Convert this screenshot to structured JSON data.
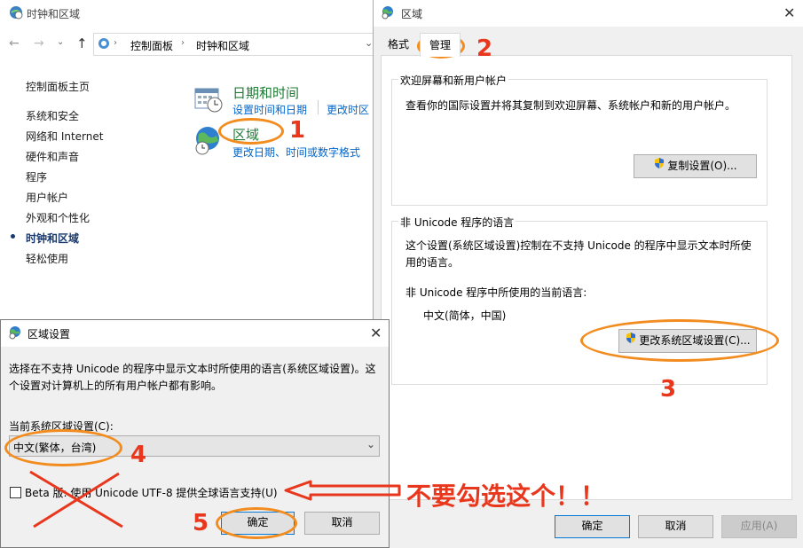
{
  "control_panel": {
    "title": "时钟和区域",
    "breadcrumb": [
      "控制面板",
      "时钟和区域"
    ],
    "sidebar": [
      {
        "label": "控制面板主页",
        "current": false
      },
      {
        "label": "系统和安全",
        "current": false
      },
      {
        "label": "网络和 Internet",
        "current": false
      },
      {
        "label": "硬件和声音",
        "current": false
      },
      {
        "label": "程序",
        "current": false
      },
      {
        "label": "用户帐户",
        "current": false
      },
      {
        "label": "外观和个性化",
        "current": false
      },
      {
        "label": "时钟和区域",
        "current": true
      },
      {
        "label": "轻松使用",
        "current": false
      }
    ],
    "datetime": {
      "title": "日期和时间",
      "link1": "设置时间和日期",
      "link2": "更改时区"
    },
    "region": {
      "title": "区域",
      "link1": "更改日期、时间或数字格式"
    }
  },
  "region_dialog": {
    "title": "区域",
    "tabs": [
      "格式",
      "管理"
    ],
    "welcome_group": {
      "title": "欢迎屏幕和新用户帐户",
      "desc": "查看你的国际设置并将其复制到欢迎屏幕、系统帐户和新的用户帐户。",
      "button": "复制设置(O)..."
    },
    "unicode_group": {
      "title": "非 Unicode 程序的语言",
      "desc_line1": "这个设置(系统区域设置)控制在不支持 Unicode 的程序中显示文本时所使",
      "desc_line2": "用的语言。",
      "current_label": "非 Unicode 程序中所使用的当前语言:",
      "current_value": "中文(简体，中国)",
      "button": "更改系统区域设置(C)..."
    },
    "footer": {
      "ok": "确定",
      "cancel": "取消",
      "apply": "应用(A)"
    }
  },
  "locale_dialog": {
    "title": "区域设置",
    "desc_line1": "选择在不支持 Unicode 的程序中显示文本时所使用的语言(系统区域设置)。这",
    "desc_line2": "个设置对计算机上的所有用户帐户都有影响。",
    "select_label": "当前系统区域设置(C):",
    "select_value": "中文(繁体，台湾)",
    "beta_checkbox": "Beta 版: 使用 Unicode UTF-8 提供全球语言支持(U)",
    "beta_checked": false,
    "ok": "确定",
    "cancel": "取消"
  },
  "annotations": {
    "n1": "1",
    "n2": "2",
    "n3": "3",
    "n4": "4",
    "n5": "5",
    "warning": "不要勾选这个！！",
    "orange": "#f28c1f",
    "red": "#e8371c"
  }
}
